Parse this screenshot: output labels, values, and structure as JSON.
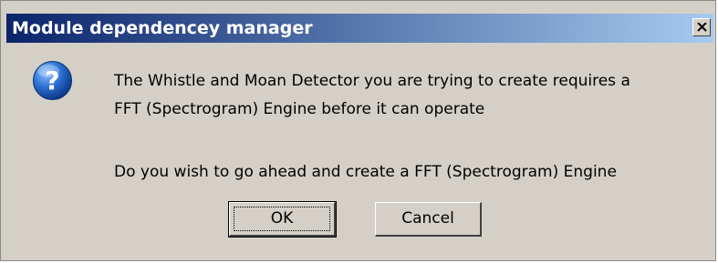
{
  "dialog": {
    "title": "Module dependencey manager",
    "close_label": "X",
    "message_line1": "The Whistle and Moan Detector you are trying to create requires a",
    "message_line2": "FFT (Spectrogram) Engine before it can operate",
    "question": "Do you wish to go ahead and create a FFT (Spectrogram) Engine",
    "icon": "question-icon",
    "ok_label": "OK",
    "cancel_label": "Cancel"
  },
  "colors": {
    "titlebar_start": "#0a246a",
    "titlebar_end": "#a6caf0",
    "dialog_bg": "#d4d0c8",
    "icon_blue": "#2a6fd1"
  }
}
